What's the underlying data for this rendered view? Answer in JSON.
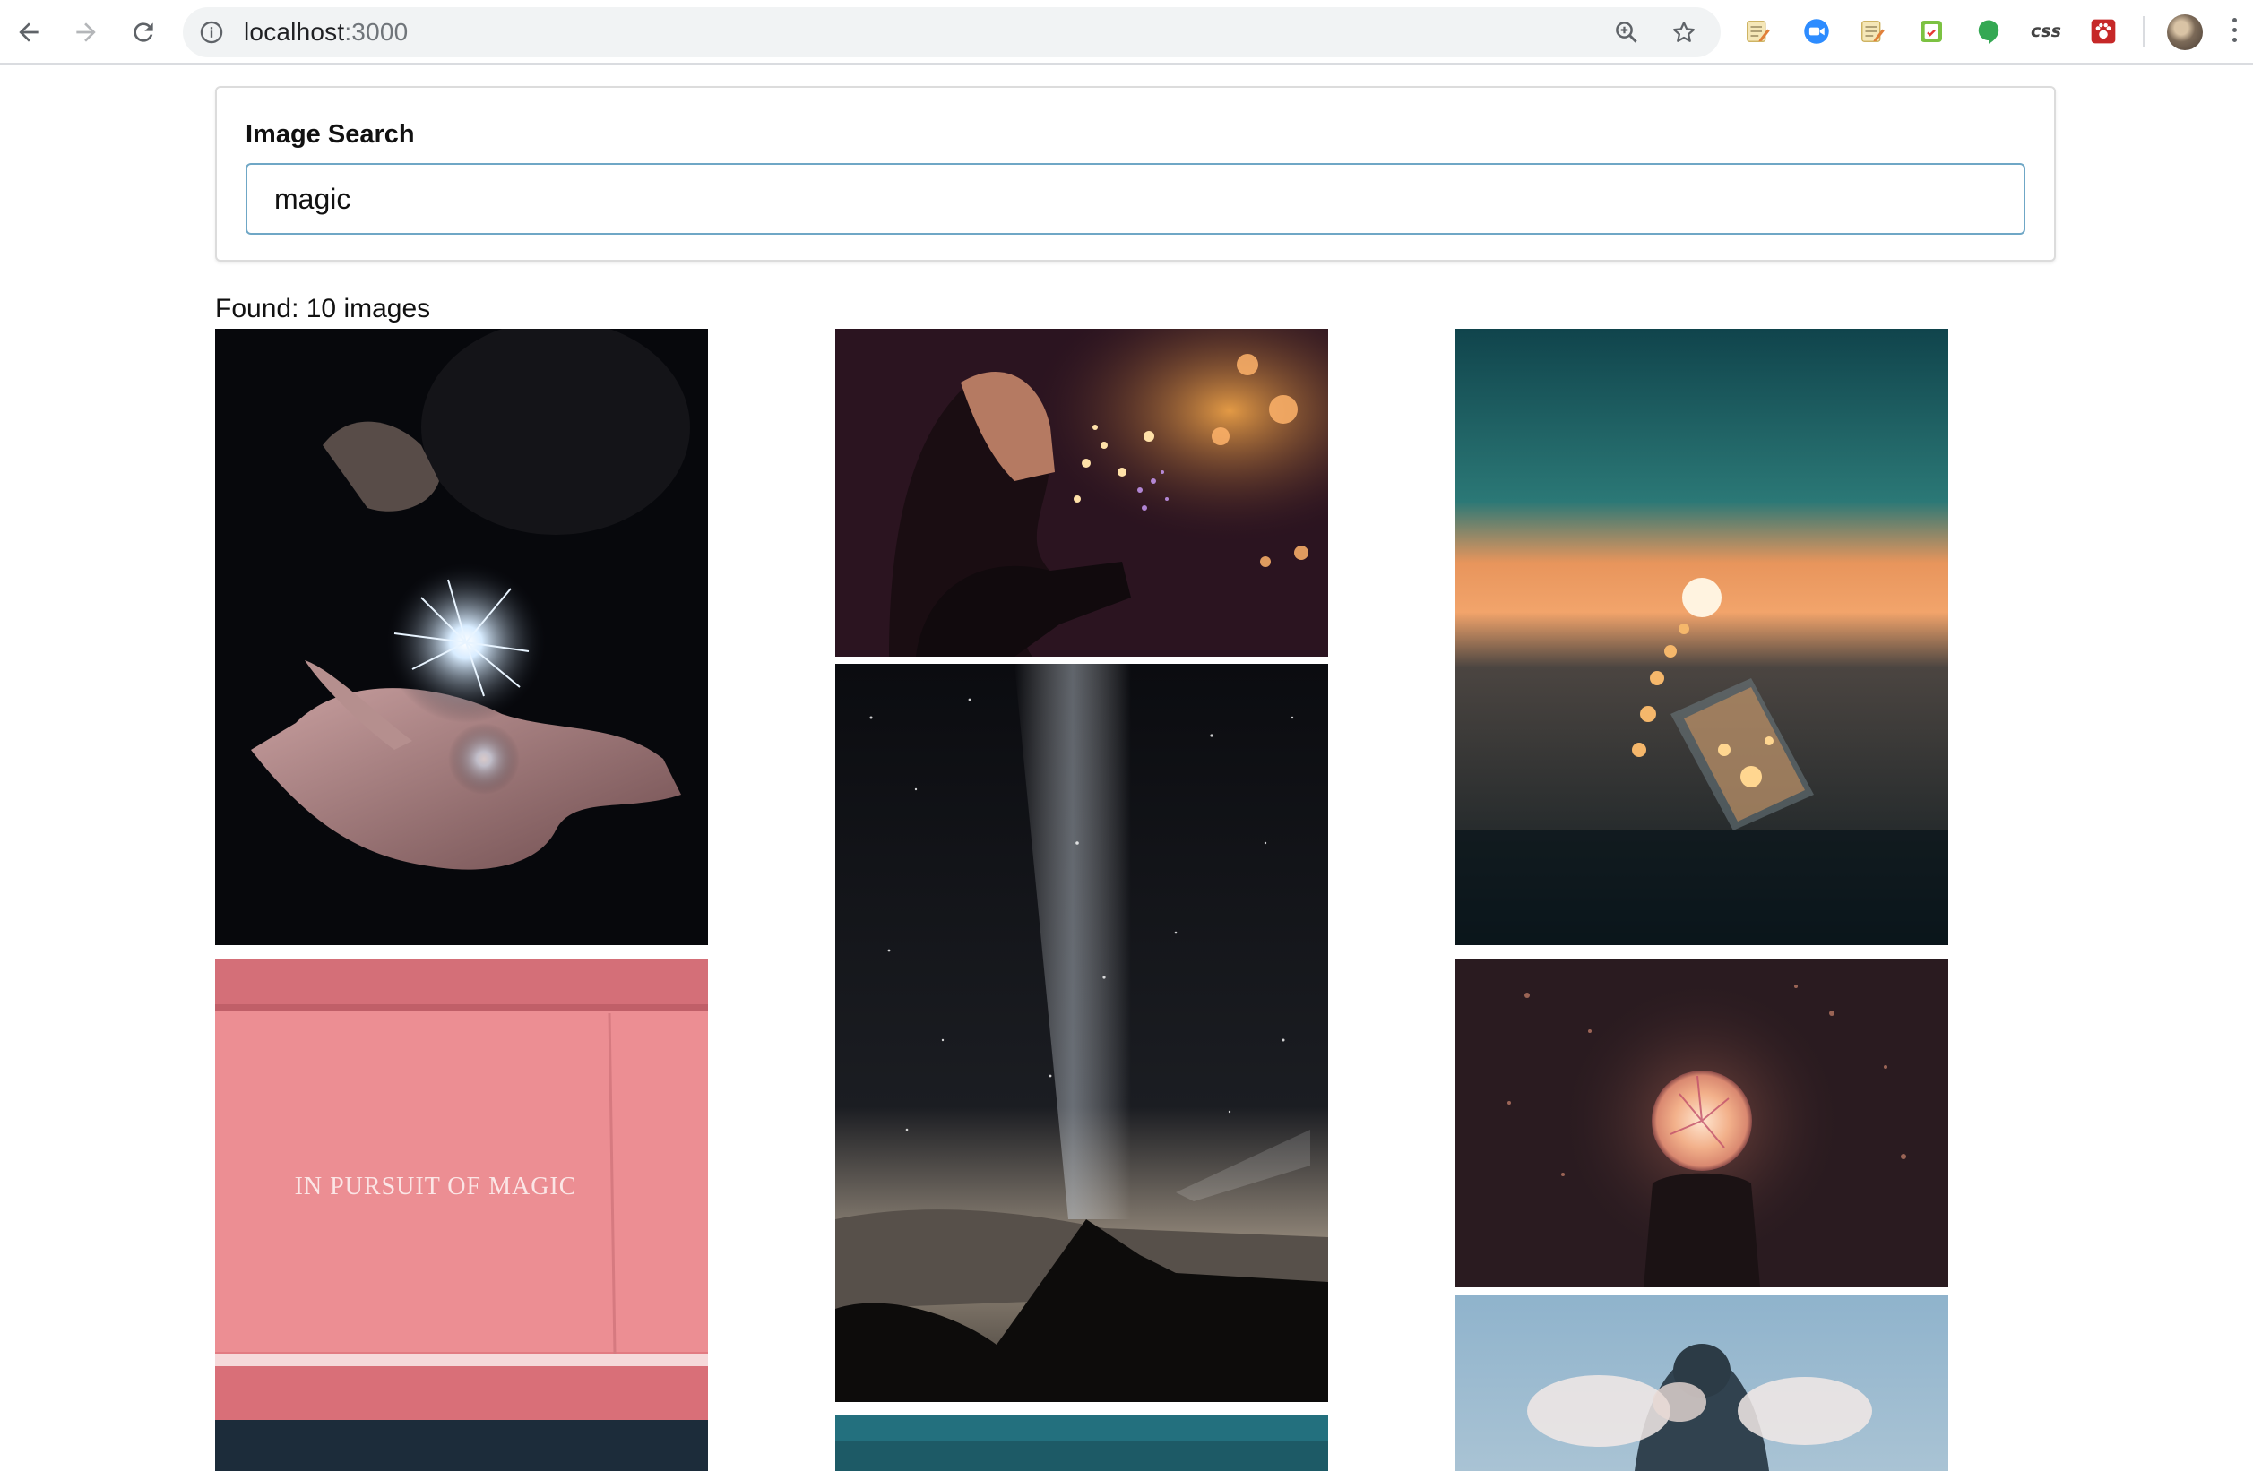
{
  "browser": {
    "url_host": "localhost",
    "url_port": ":3000",
    "extensions": [
      "notepad-icon",
      "zoom-icon",
      "notepad-icon",
      "clipboard-icon",
      "hangouts-icon",
      "css-icon",
      "paw-icon"
    ],
    "css_extension_label": "css"
  },
  "search": {
    "label": "Image Search",
    "value": "magic"
  },
  "results": {
    "found_text": "Found: 10 images",
    "pink_image_text": "IN PURSUIT OF MAGIC"
  },
  "colors": {
    "input_border": "#6fa7c6",
    "card_border": "#dcdcdc"
  }
}
